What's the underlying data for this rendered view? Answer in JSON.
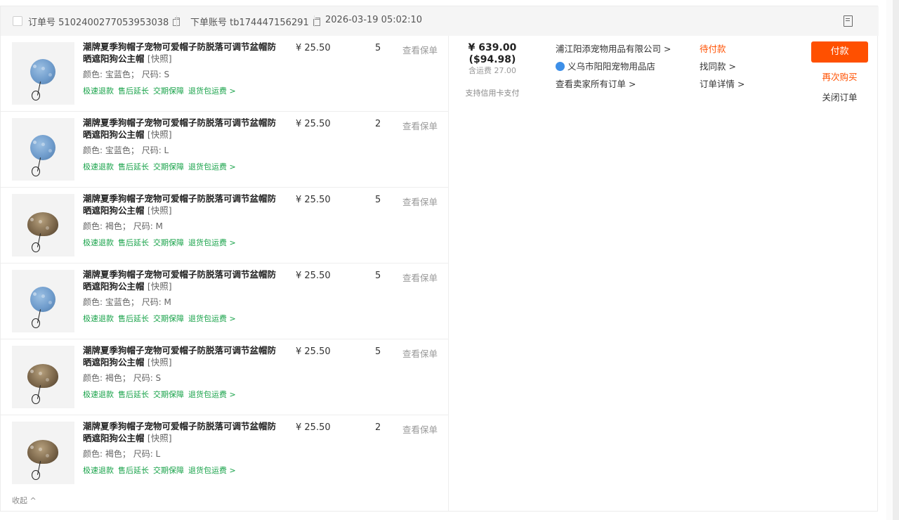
{
  "header": {
    "order_label": "订单号",
    "order_no": "5102400277053953038",
    "account_label": "下单账号",
    "account": "tb174447156291",
    "date": "2026-03-19 05:02:10"
  },
  "items": [
    {
      "title": "潮牌夏季狗帽子宠物可爱帽子防脱落可调节盆帽防晒遮阳狗公主帽",
      "snapshot": "[快照]",
      "color": "颜色: 宝蓝色；",
      "size": "尺码: S",
      "price": "¥ 25.50",
      "qty": "5",
      "policy": "查看保单",
      "hat": "blue"
    },
    {
      "title": "潮牌夏季狗帽子宠物可爱帽子防脱落可调节盆帽防晒遮阳狗公主帽",
      "snapshot": "[快照]",
      "color": "颜色: 宝蓝色；",
      "size": "尺码: L",
      "price": "¥ 25.50",
      "qty": "2",
      "policy": "查看保单",
      "hat": "blue"
    },
    {
      "title": "潮牌夏季狗帽子宠物可爱帽子防脱落可调节盆帽防晒遮阳狗公主帽",
      "snapshot": "[快照]",
      "color": "颜色: 褐色；",
      "size": "尺码: M",
      "price": "¥ 25.50",
      "qty": "5",
      "policy": "查看保单",
      "hat": "brown"
    },
    {
      "title": "潮牌夏季狗帽子宠物可爱帽子防脱落可调节盆帽防晒遮阳狗公主帽",
      "snapshot": "[快照]",
      "color": "颜色: 宝蓝色；",
      "size": "尺码: M",
      "price": "¥ 25.50",
      "qty": "5",
      "policy": "查看保单",
      "hat": "blue"
    },
    {
      "title": "潮牌夏季狗帽子宠物可爱帽子防脱落可调节盆帽防晒遮阳狗公主帽",
      "snapshot": "[快照]",
      "color": "颜色: 褐色；",
      "size": "尺码: S",
      "price": "¥ 25.50",
      "qty": "5",
      "policy": "查看保单",
      "hat": "brown"
    },
    {
      "title": "潮牌夏季狗帽子宠物可爱帽子防脱落可调节盆帽防晒遮阳狗公主帽",
      "snapshot": "[快照]",
      "color": "颜色: 褐色；",
      "size": "尺码: L",
      "price": "¥ 25.50",
      "qty": "2",
      "policy": "查看保单",
      "hat": "brown"
    }
  ],
  "services": [
    "极速退款",
    "售后延长",
    "交期保障",
    "退货包运费 >"
  ],
  "collapse": "收起 ^",
  "total": {
    "amount": "¥ 639.00",
    "usd": "($94.98)",
    "shipping": "含运费 27.00",
    "credit": "支持信用卡支付"
  },
  "seller": {
    "company": "浦江阳添宠物用品有限公司 >",
    "shop": "义乌市阳阳宠物用品店",
    "all_orders": "查看卖家所有订单 >"
  },
  "status": {
    "state": "待付款",
    "similar": "找同款 >",
    "detail": "订单详情 >"
  },
  "actions": {
    "pay": "付款",
    "rebuy": "再次购买",
    "close": "关闭订单"
  },
  "colors": {
    "accent": "#ff5000",
    "service_green": "#19a34a"
  }
}
